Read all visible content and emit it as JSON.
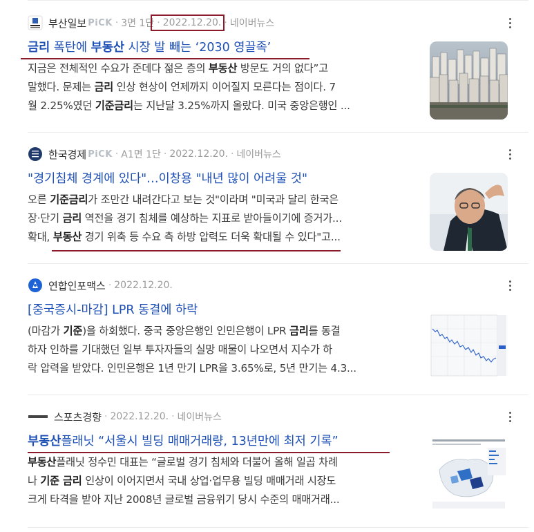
{
  "articles": [
    {
      "press": "부산일보",
      "pick": "PiCK",
      "section": "3면 1단",
      "date": "2022.12.20.",
      "source": "네이버뉴스",
      "title_parts": [
        {
          "t": "금리",
          "b": true
        },
        {
          "t": " 폭탄에 ",
          "b": false
        },
        {
          "t": "부동산",
          "b": true
        },
        {
          "t": " 시장 발 빼는 ‘2030 영끌족’",
          "b": false
        }
      ],
      "desc_lines": [
        [
          {
            "t": "지금은 전체적인 수요가 준데다 젊은 층의 ",
            "b": false
          },
          {
            "t": "부동산",
            "b": true
          },
          {
            "t": " 방문도 거의 없다”고",
            "b": false
          }
        ],
        [
          {
            "t": "말했다. 문제는 ",
            "b": false
          },
          {
            "t": "금리",
            "b": true
          },
          {
            "t": " 인상 현상이 언제까지 이어질지 모른다는 점이다. 7",
            "b": false
          }
        ],
        [
          {
            "t": "월 2.25%였던 ",
            "b": false
          },
          {
            "t": "기준금리",
            "b": true
          },
          {
            "t": "는 지난달 3.25%까지 올랐다. 미국 중앙은행인 ...",
            "b": false
          }
        ]
      ]
    },
    {
      "press": "한국경제",
      "pick": "PiCK",
      "section": "A1면 1단",
      "date": "2022.12.20.",
      "source": "네이버뉴스",
      "title_parts": [
        {
          "t": "\"경기침체 경계에 있다\"…이창용 \"내년 많이 어려울 것\"",
          "b": false
        }
      ],
      "desc_lines": [
        [
          {
            "t": "오른 ",
            "b": false
          },
          {
            "t": "기준금리",
            "b": true
          },
          {
            "t": "가 조만간 내려간다고 보는 것\"이라며 \"미국과 달리 한국은",
            "b": false
          }
        ],
        [
          {
            "t": "장·단기 ",
            "b": false
          },
          {
            "t": "금리",
            "b": true
          },
          {
            "t": " 역전을 경기 침체를 예상하는 지표로 받아들이기에 증거가...",
            "b": false
          }
        ],
        [
          {
            "t": "확대, ",
            "b": false
          },
          {
            "t": "부동산",
            "b": true
          },
          {
            "t": " 경기 위축 등 수요 측 하방 압력도 더욱 확대될 수 있다\"고...",
            "b": false
          }
        ]
      ]
    },
    {
      "press": "연합인포맥스",
      "date": "2022.12.20.",
      "title_parts": [
        {
          "t": "[중국증시-마감] LPR 동결에 하락",
          "b": false
        }
      ],
      "desc_lines": [
        [
          {
            "t": "(마감가 ",
            "b": false
          },
          {
            "t": "기준",
            "b": true
          },
          {
            "t": ")을 하회했다. 중국 중앙은행인 인민은행이 LPR ",
            "b": false
          },
          {
            "t": "금리",
            "b": true
          },
          {
            "t": "를 동결",
            "b": false
          }
        ],
        [
          {
            "t": "하자 인하를 기대했던 일부 투자자들의 실망 매물이 나오면서 지수가 하",
            "b": false
          }
        ],
        [
          {
            "t": "락 압력을 받았다. 인민은행은 1년 만기 LPR을 3.65%로, 5년 만기는 4.3...",
            "b": false
          }
        ]
      ]
    },
    {
      "press": "스포츠경향",
      "date": "2022.12.20.",
      "source": "네이버뉴스",
      "logo_text": "스포츠경향",
      "title_parts": [
        {
          "t": "부동산",
          "b": true
        },
        {
          "t": "플래닛 “서울시 빌딩 매매거래량, 13년만에 최저 기록”",
          "b": false
        }
      ],
      "desc_lines": [
        [
          {
            "t": "부동산",
            "b": true
          },
          {
            "t": "플래닛 정수민 대표는 “글로벌 경기 침체와 더불어 올해 일곱 차례",
            "b": false
          }
        ],
        [
          {
            "t": "나 ",
            "b": false
          },
          {
            "t": "기준 금리",
            "b": true
          },
          {
            "t": " 인상이 이어지면서 국내 상업·업무용 빌딩 매매거래 시장도",
            "b": false
          }
        ],
        [
          {
            "t": "크게 타격을 받아 지난 2008년 글로벌 금융위기 당시 수준의 매매거래...",
            "b": false
          }
        ]
      ]
    }
  ],
  "colors": {
    "title": "#1d4fb5",
    "annotation": "#8b1a2b"
  }
}
